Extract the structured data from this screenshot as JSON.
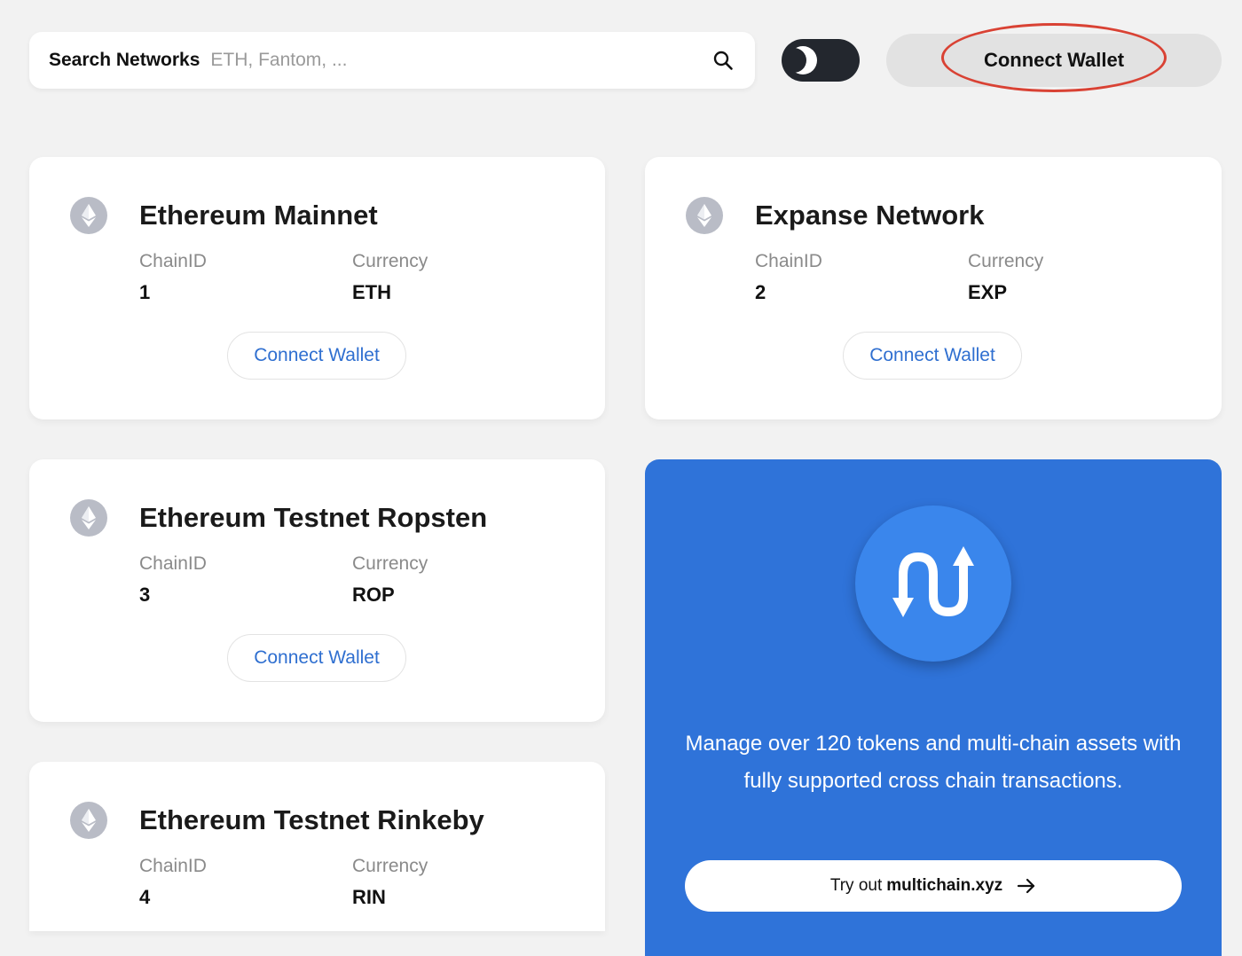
{
  "search": {
    "label": "Search Networks",
    "placeholder": "ETH, Fantom, ...",
    "value": "",
    "icon": "search-icon"
  },
  "theme_toggle": {
    "icon": "moon-icon",
    "state": "dark"
  },
  "header": {
    "connect_label": "Connect Wallet"
  },
  "labels": {
    "chain_id": "ChainID",
    "currency": "Currency",
    "connect": "Connect Wallet"
  },
  "networks": [
    {
      "name": "Ethereum Mainnet",
      "chain_id": "1",
      "currency": "ETH",
      "icon": "ethereum-icon"
    },
    {
      "name": "Expanse Network",
      "chain_id": "2",
      "currency": "EXP",
      "icon": "ethereum-icon"
    },
    {
      "name": "Ethereum Testnet Ropsten",
      "chain_id": "3",
      "currency": "ROP",
      "icon": "ethereum-icon"
    },
    {
      "name": "Ethereum Testnet Rinkeby",
      "chain_id": "4",
      "currency": "RIN",
      "icon": "ethereum-icon"
    }
  ],
  "promo": {
    "text": "Manage over 120 tokens and multi-chain assets with fully supported cross chain transactions.",
    "button_prefix": "Try out",
    "button_domain": "multichain.xyz",
    "logo_icon": "multichain-logo-icon",
    "arrow_icon": "arrow-right-icon"
  },
  "colors": {
    "accent": "#2f6fd0",
    "promo_bg": "#2f73d9",
    "highlight": "#d94234",
    "toggle_bg": "#23272e",
    "page_bg": "#f2f2f2"
  }
}
